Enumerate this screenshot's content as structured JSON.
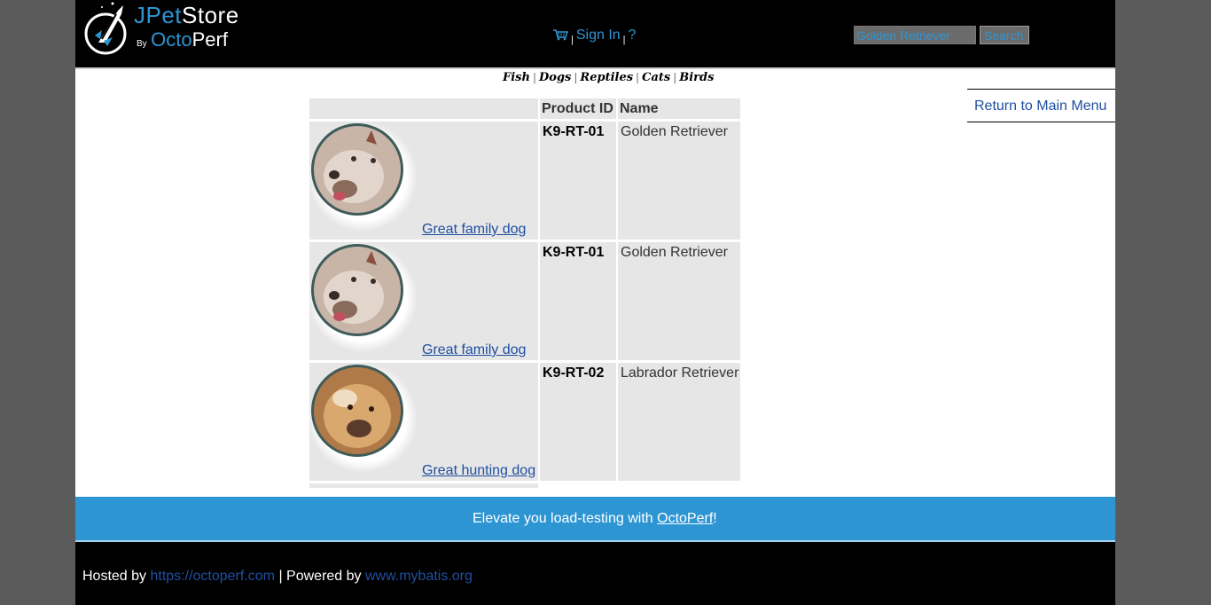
{
  "logo": {
    "part1": "JPet",
    "part2": "Store",
    "by": "By",
    "octo": "Octo",
    "perf": "Perf"
  },
  "menu": {
    "sign_in": "Sign In",
    "help": "?",
    "sep": "|"
  },
  "search": {
    "value": "Golden Retriever",
    "button": "Search"
  },
  "quick": {
    "fish": "Fish",
    "dogs": "Dogs",
    "reptiles": "Reptiles",
    "cats": "Cats",
    "birds": "Birds",
    "sep": "|"
  },
  "back": {
    "label": "Return to Main Menu"
  },
  "table": {
    "headers": [
      "",
      "Product ID",
      "Name"
    ],
    "rows": [
      {
        "desc": "Great family dog",
        "id": "K9-RT-01",
        "name": "Golden Retriever",
        "img": "bulldog"
      },
      {
        "desc": "Great family dog",
        "id": "K9-RT-01",
        "name": "Golden Retriever",
        "img": "bulldog"
      },
      {
        "desc": "Great hunting dog",
        "id": "K9-RT-02",
        "name": "Labrador Retriever",
        "img": "spaniel"
      }
    ]
  },
  "banner": {
    "prefix": "Elevate you load-testing with ",
    "link": "OctoPerf",
    "suffix": "!"
  },
  "footer": {
    "hosted": "Hosted by ",
    "host_link": "https://octoperf.com",
    "powered": " | Powered by ",
    "powered_link": "www.mybatis.org"
  },
  "colors": {
    "accent": "#2e95d3",
    "link": "#1f4fa0",
    "header_bg": "#000000",
    "cell_bg": "#e6e6e6"
  }
}
